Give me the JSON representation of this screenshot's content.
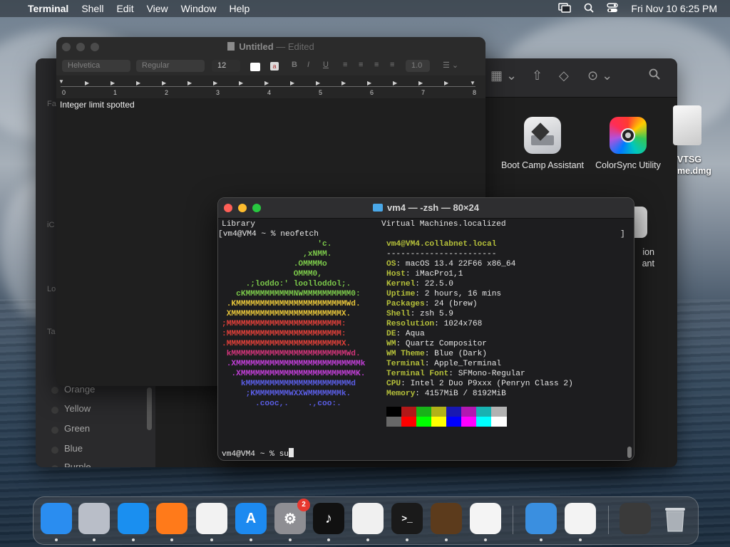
{
  "menubar": {
    "app": "Terminal",
    "items": [
      "Shell",
      "Edit",
      "View",
      "Window",
      "Help"
    ],
    "datetime": "Fri Nov 10  6:25 PM"
  },
  "finder": {
    "sidebar_labels": [
      "Fa",
      "iC",
      "Lo",
      "Ta"
    ],
    "tags": [
      "Orange",
      "Yellow",
      "Green",
      "Blue",
      "Purple"
    ],
    "apps": [
      {
        "name": "Boot Camp Assistant"
      },
      {
        "name": "ColorSync Utility"
      }
    ],
    "partial_item": "ion\nant"
  },
  "desktop": {
    "file_label": "VTSG\nme.dmg"
  },
  "textedit": {
    "title": "Untitled",
    "edited": "Edited",
    "font": "Helvetica",
    "style": "Regular",
    "size": "12",
    "line_spacing": "1.0",
    "ruler_numbers": [
      "0",
      "1",
      "2",
      "3",
      "4",
      "5",
      "6",
      "7",
      "8"
    ],
    "body_text": "Integer limit spotted"
  },
  "terminal": {
    "title": "vm4 — -zsh — 80×24",
    "line_library": "Library",
    "line_vm": "Virtual Machines.localized",
    "prompt_cmd": "[vm4@VM4 ~ % neofetch",
    "bracket_end": "]",
    "user_host": "vm4@VM4.collabnet.local",
    "separator": "-----------------------",
    "info": [
      {
        "k": "OS",
        "v": "macOS 13.4 22F66 x86_64"
      },
      {
        "k": "Host",
        "v": "iMacPro1,1"
      },
      {
        "k": "Kernel",
        "v": "22.5.0"
      },
      {
        "k": "Uptime",
        "v": "2 hours, 16 mins"
      },
      {
        "k": "Packages",
        "v": "24 (brew)"
      },
      {
        "k": "Shell",
        "v": "zsh 5.9"
      },
      {
        "k": "Resolution",
        "v": "1024x768"
      },
      {
        "k": "DE",
        "v": "Aqua"
      },
      {
        "k": "WM",
        "v": "Quartz Compositor"
      },
      {
        "k": "WM Theme",
        "v": "Blue (Dark)"
      },
      {
        "k": "Terminal",
        "v": "Apple_Terminal"
      },
      {
        "k": "Terminal Font",
        "v": "SFMono-Regular"
      },
      {
        "k": "CPU",
        "v": "Intel 2 Duo P9xxx (Penryn Class 2)"
      },
      {
        "k": "Memory",
        "v": "4157MiB / 8192MiB"
      }
    ],
    "art": [
      {
        "t": "                    'c.",
        "c": "#7bc84a"
      },
      {
        "t": "                 ,xNMM.",
        "c": "#7bc84a"
      },
      {
        "t": "               .OMMMMo",
        "c": "#7bc84a"
      },
      {
        "t": "               OMMM0,",
        "c": "#7bc84a"
      },
      {
        "t": "     .;loddo:' loolloddol;.",
        "c": "#7bc84a"
      },
      {
        "t": "   cKMMMMMMMMMMNWMMMMMMMMMM0:",
        "c": "#7bc84a"
      },
      {
        "t": " .KMMMMMMMMMMMMMMMMMMMMMMMWd.",
        "c": "#e6c43a"
      },
      {
        "t": " XMMMMMMMMMMMMMMMMMMMMMMMX.",
        "c": "#e6c43a"
      },
      {
        "t": ";MMMMMMMMMMMMMMMMMMMMMMMM:",
        "c": "#e0403a"
      },
      {
        "t": ":MMMMMMMMMMMMMMMMMMMMMMMM:",
        "c": "#e0403a"
      },
      {
        "t": ".MMMMMMMMMMMMMMMMMMMMMMMMX.",
        "c": "#e0403a"
      },
      {
        "t": " kMMMMMMMMMMMMMMMMMMMMMMMMWd.",
        "c": "#d2357a"
      },
      {
        "t": " .XMMMMMMMMMMMMMMMMMMMMMMMMMMk",
        "c": "#c23fd8"
      },
      {
        "t": "  .XMMMMMMMMMMMMMMMMMMMMMMMMK.",
        "c": "#c23fd8"
      },
      {
        "t": "    kMMMMMMMMMMMMMMMMMMMMMMd",
        "c": "#5b5ee6"
      },
      {
        "t": "     ;KMMMMMMMWXXWMMMMMMMk.",
        "c": "#5b5ee6"
      },
      {
        "t": "       .cooc,.    .,coo:.",
        "c": "#5b5ee6"
      }
    ],
    "colors_top": [
      "#000000",
      "#b21818",
      "#18b218",
      "#b2b218",
      "#1818b2",
      "#b218b2",
      "#18b2b2",
      "#b2b2b2"
    ],
    "colors_bottom": [
      "#686868",
      "#ff0000",
      "#00ff00",
      "#ffff00",
      "#0000ff",
      "#ff00ff",
      "#00ffff",
      "#ffffff"
    ],
    "final_prompt": "vm4@VM4 ~ % su"
  },
  "dock": {
    "settings_badge": "2",
    "apps": [
      {
        "name": "finder-icon",
        "color": "#2a8df0",
        "glyph": ""
      },
      {
        "name": "launchpad-icon",
        "color": "#b9bec8",
        "glyph": ""
      },
      {
        "name": "safari-icon",
        "color": "#1a8ff0",
        "glyph": ""
      },
      {
        "name": "firefox-icon",
        "color": "#ff7a1a",
        "glyph": ""
      },
      {
        "name": "chrome-icon",
        "color": "#f2f2f2",
        "glyph": ""
      },
      {
        "name": "app-store-icon",
        "color": "#1d8af0",
        "glyph": "A"
      },
      {
        "name": "system-settings-icon",
        "color": "#8e8e93",
        "glyph": "⚙"
      },
      {
        "name": "tiktok-icon",
        "color": "#111111",
        "glyph": "♪"
      },
      {
        "name": "textedit-icon",
        "color": "#f0f0f0",
        "glyph": ""
      },
      {
        "name": "terminal-icon",
        "color": "#1a1a1a",
        "glyph": ">_"
      },
      {
        "name": "instruments-icon",
        "color": "#5c3b1c",
        "glyph": ""
      },
      {
        "name": "vscode-icon",
        "color": "#f4f4f4",
        "glyph": ""
      },
      {
        "name": "weather-icon",
        "color": "#3a8fe0",
        "glyph": ""
      },
      {
        "name": "parallels-icon",
        "color": "#f3f3f3",
        "glyph": ""
      },
      {
        "name": "downloads-stack-icon",
        "color": "#3a3a3a",
        "glyph": ""
      },
      {
        "name": "trash-icon",
        "color": "transparent",
        "glyph": ""
      }
    ]
  }
}
